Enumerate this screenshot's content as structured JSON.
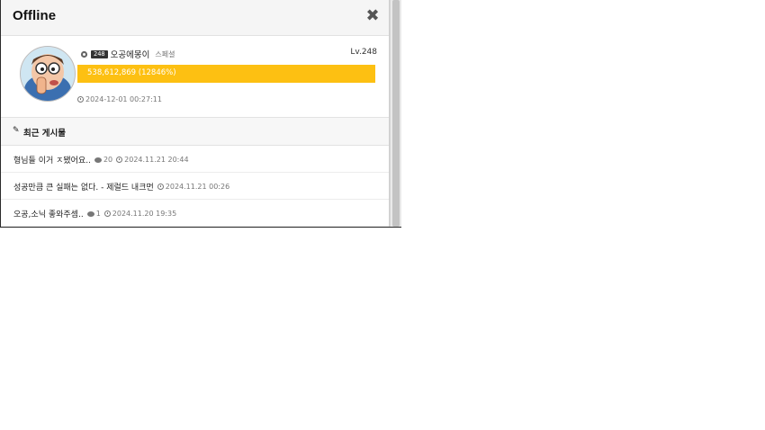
{
  "modal": {
    "title": "Offline",
    "close_icon": "close-icon"
  },
  "profile": {
    "level_badge": "248",
    "nickname": "오공에몽이",
    "grade": "스페셜",
    "level_text": "Lv.248",
    "exp_text": "538,612,869 (12846%)",
    "exp_percent": 100,
    "last_login": "2024-12-01 00:27:11",
    "exp_color": "#fdc012"
  },
  "recent": {
    "title": "최근 게시물",
    "posts": [
      {
        "title": "형님들 이거 ㅈ됐어요..",
        "comments": "20",
        "date": "2024.11.21 20:44"
      },
      {
        "title": "성공만큼 큰 실패는 없다. - 제럴드 내크먼",
        "comments": "",
        "date": "2024.11.21 00:26"
      },
      {
        "title": "오공,소닉 좋와주셈..",
        "comments": "1",
        "date": "2024.11.20 19:35"
      }
    ]
  }
}
